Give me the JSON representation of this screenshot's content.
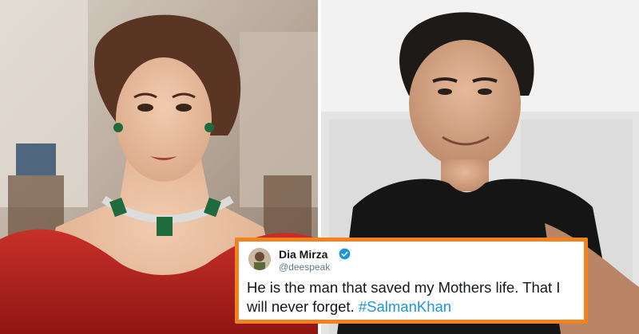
{
  "tweet": {
    "name": "Dia Mirza",
    "handle": "@deespeak",
    "text": "He is the man that saved my Mothers life. That I will never forget.",
    "hashtag": "#SalmanKhan",
    "verified": true,
    "accent_color": "#1b95e0",
    "border_color": "#f2811e"
  }
}
